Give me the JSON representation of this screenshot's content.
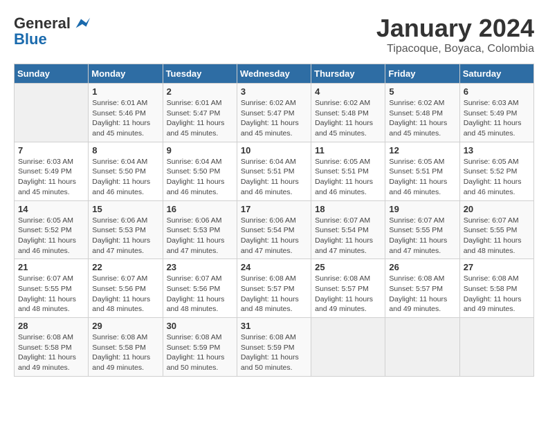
{
  "logo": {
    "general": "General",
    "blue": "Blue"
  },
  "header": {
    "month": "January 2024",
    "location": "Tipacoque, Boyaca, Colombia"
  },
  "days_of_week": [
    "Sunday",
    "Monday",
    "Tuesday",
    "Wednesday",
    "Thursday",
    "Friday",
    "Saturday"
  ],
  "weeks": [
    [
      {
        "day": "",
        "sunrise": "",
        "sunset": "",
        "daylight": ""
      },
      {
        "day": "1",
        "sunrise": "Sunrise: 6:01 AM",
        "sunset": "Sunset: 5:46 PM",
        "daylight": "Daylight: 11 hours and 45 minutes."
      },
      {
        "day": "2",
        "sunrise": "Sunrise: 6:01 AM",
        "sunset": "Sunset: 5:47 PM",
        "daylight": "Daylight: 11 hours and 45 minutes."
      },
      {
        "day": "3",
        "sunrise": "Sunrise: 6:02 AM",
        "sunset": "Sunset: 5:47 PM",
        "daylight": "Daylight: 11 hours and 45 minutes."
      },
      {
        "day": "4",
        "sunrise": "Sunrise: 6:02 AM",
        "sunset": "Sunset: 5:48 PM",
        "daylight": "Daylight: 11 hours and 45 minutes."
      },
      {
        "day": "5",
        "sunrise": "Sunrise: 6:02 AM",
        "sunset": "Sunset: 5:48 PM",
        "daylight": "Daylight: 11 hours and 45 minutes."
      },
      {
        "day": "6",
        "sunrise": "Sunrise: 6:03 AM",
        "sunset": "Sunset: 5:49 PM",
        "daylight": "Daylight: 11 hours and 45 minutes."
      }
    ],
    [
      {
        "day": "7",
        "sunrise": "Sunrise: 6:03 AM",
        "sunset": "Sunset: 5:49 PM",
        "daylight": "Daylight: 11 hours and 45 minutes."
      },
      {
        "day": "8",
        "sunrise": "Sunrise: 6:04 AM",
        "sunset": "Sunset: 5:50 PM",
        "daylight": "Daylight: 11 hours and 46 minutes."
      },
      {
        "day": "9",
        "sunrise": "Sunrise: 6:04 AM",
        "sunset": "Sunset: 5:50 PM",
        "daylight": "Daylight: 11 hours and 46 minutes."
      },
      {
        "day": "10",
        "sunrise": "Sunrise: 6:04 AM",
        "sunset": "Sunset: 5:51 PM",
        "daylight": "Daylight: 11 hours and 46 minutes."
      },
      {
        "day": "11",
        "sunrise": "Sunrise: 6:05 AM",
        "sunset": "Sunset: 5:51 PM",
        "daylight": "Daylight: 11 hours and 46 minutes."
      },
      {
        "day": "12",
        "sunrise": "Sunrise: 6:05 AM",
        "sunset": "Sunset: 5:51 PM",
        "daylight": "Daylight: 11 hours and 46 minutes."
      },
      {
        "day": "13",
        "sunrise": "Sunrise: 6:05 AM",
        "sunset": "Sunset: 5:52 PM",
        "daylight": "Daylight: 11 hours and 46 minutes."
      }
    ],
    [
      {
        "day": "14",
        "sunrise": "Sunrise: 6:05 AM",
        "sunset": "Sunset: 5:52 PM",
        "daylight": "Daylight: 11 hours and 46 minutes."
      },
      {
        "day": "15",
        "sunrise": "Sunrise: 6:06 AM",
        "sunset": "Sunset: 5:53 PM",
        "daylight": "Daylight: 11 hours and 47 minutes."
      },
      {
        "day": "16",
        "sunrise": "Sunrise: 6:06 AM",
        "sunset": "Sunset: 5:53 PM",
        "daylight": "Daylight: 11 hours and 47 minutes."
      },
      {
        "day": "17",
        "sunrise": "Sunrise: 6:06 AM",
        "sunset": "Sunset: 5:54 PM",
        "daylight": "Daylight: 11 hours and 47 minutes."
      },
      {
        "day": "18",
        "sunrise": "Sunrise: 6:07 AM",
        "sunset": "Sunset: 5:54 PM",
        "daylight": "Daylight: 11 hours and 47 minutes."
      },
      {
        "day": "19",
        "sunrise": "Sunrise: 6:07 AM",
        "sunset": "Sunset: 5:55 PM",
        "daylight": "Daylight: 11 hours and 47 minutes."
      },
      {
        "day": "20",
        "sunrise": "Sunrise: 6:07 AM",
        "sunset": "Sunset: 5:55 PM",
        "daylight": "Daylight: 11 hours and 48 minutes."
      }
    ],
    [
      {
        "day": "21",
        "sunrise": "Sunrise: 6:07 AM",
        "sunset": "Sunset: 5:55 PM",
        "daylight": "Daylight: 11 hours and 48 minutes."
      },
      {
        "day": "22",
        "sunrise": "Sunrise: 6:07 AM",
        "sunset": "Sunset: 5:56 PM",
        "daylight": "Daylight: 11 hours and 48 minutes."
      },
      {
        "day": "23",
        "sunrise": "Sunrise: 6:07 AM",
        "sunset": "Sunset: 5:56 PM",
        "daylight": "Daylight: 11 hours and 48 minutes."
      },
      {
        "day": "24",
        "sunrise": "Sunrise: 6:08 AM",
        "sunset": "Sunset: 5:57 PM",
        "daylight": "Daylight: 11 hours and 48 minutes."
      },
      {
        "day": "25",
        "sunrise": "Sunrise: 6:08 AM",
        "sunset": "Sunset: 5:57 PM",
        "daylight": "Daylight: 11 hours and 49 minutes."
      },
      {
        "day": "26",
        "sunrise": "Sunrise: 6:08 AM",
        "sunset": "Sunset: 5:57 PM",
        "daylight": "Daylight: 11 hours and 49 minutes."
      },
      {
        "day": "27",
        "sunrise": "Sunrise: 6:08 AM",
        "sunset": "Sunset: 5:58 PM",
        "daylight": "Daylight: 11 hours and 49 minutes."
      }
    ],
    [
      {
        "day": "28",
        "sunrise": "Sunrise: 6:08 AM",
        "sunset": "Sunset: 5:58 PM",
        "daylight": "Daylight: 11 hours and 49 minutes."
      },
      {
        "day": "29",
        "sunrise": "Sunrise: 6:08 AM",
        "sunset": "Sunset: 5:58 PM",
        "daylight": "Daylight: 11 hours and 49 minutes."
      },
      {
        "day": "30",
        "sunrise": "Sunrise: 6:08 AM",
        "sunset": "Sunset: 5:59 PM",
        "daylight": "Daylight: 11 hours and 50 minutes."
      },
      {
        "day": "31",
        "sunrise": "Sunrise: 6:08 AM",
        "sunset": "Sunset: 5:59 PM",
        "daylight": "Daylight: 11 hours and 50 minutes."
      },
      {
        "day": "",
        "sunrise": "",
        "sunset": "",
        "daylight": ""
      },
      {
        "day": "",
        "sunrise": "",
        "sunset": "",
        "daylight": ""
      },
      {
        "day": "",
        "sunrise": "",
        "sunset": "",
        "daylight": ""
      }
    ]
  ]
}
